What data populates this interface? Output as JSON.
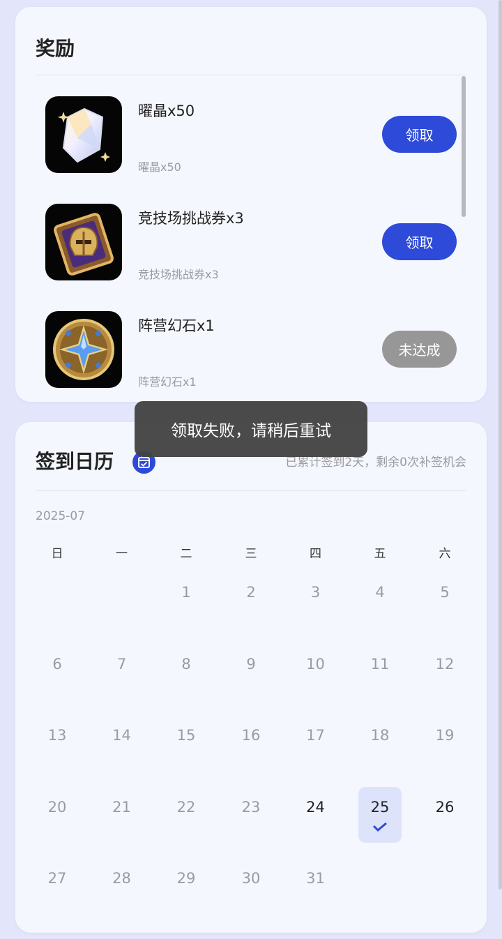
{
  "rewards": {
    "title": "奖励",
    "items": [
      {
        "name": "曜晶x50",
        "desc": "曜晶x50",
        "button": "领取",
        "status": "available",
        "icon": "crystal-icon"
      },
      {
        "name": "竞技场挑战券x3",
        "desc": "竞技场挑战券x3",
        "button": "领取",
        "status": "available",
        "icon": "arena-ticket-icon"
      },
      {
        "name": "阵营幻石x1",
        "desc": "阵营幻石x1",
        "button": "未达成",
        "status": "unmet",
        "icon": "faction-stone-icon"
      }
    ]
  },
  "calendar": {
    "title": "签到日历",
    "summary": "已累计签到2天，剩余0次补签机会",
    "month": "2025-07",
    "weekdays": [
      "日",
      "一",
      "二",
      "三",
      "四",
      "五",
      "六"
    ],
    "first_weekday": 2,
    "days": 31,
    "active_days": [
      24,
      25,
      26
    ],
    "signed_days": [
      25
    ]
  },
  "toast": {
    "message": "领取失败，请稍后重试"
  },
  "colors": {
    "accent": "#2d4ad8",
    "disabled": "#979797",
    "card": "#f5f7fe",
    "background": "#e3e6fb"
  }
}
